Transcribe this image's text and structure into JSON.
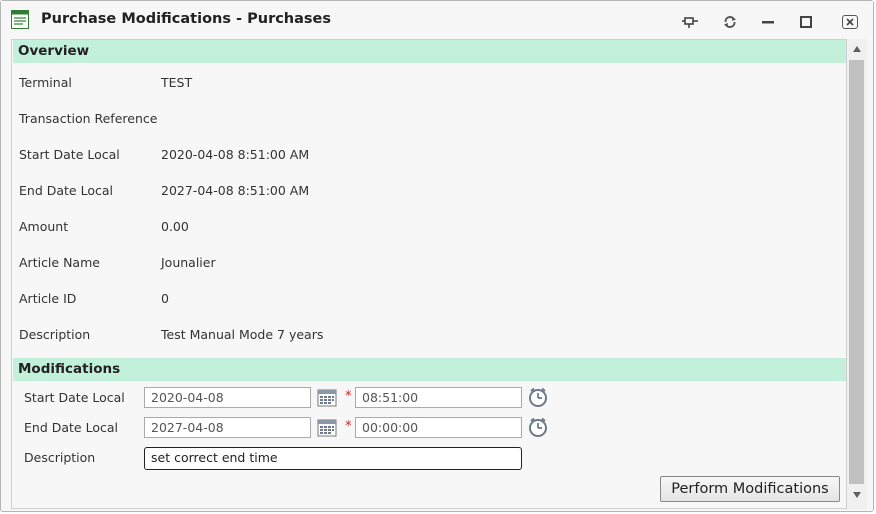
{
  "window": {
    "title": "Purchase Modifications - Purchases"
  },
  "overview": {
    "header": "Overview",
    "rows": [
      {
        "label": "Terminal",
        "value": "TEST"
      },
      {
        "label": "Transaction Reference",
        "value": ""
      },
      {
        "label": "Start Date Local",
        "value": "2020-04-08 8:51:00 AM"
      },
      {
        "label": "End Date Local",
        "value": "2027-04-08 8:51:00 AM"
      },
      {
        "label": "Amount",
        "value": "0.00"
      },
      {
        "label": "Article Name",
        "value": "Jounalier"
      },
      {
        "label": "Article ID",
        "value": "0"
      },
      {
        "label": "Description",
        "value": "Test Manual Mode 7 years"
      }
    ]
  },
  "modifications": {
    "header": "Modifications",
    "start_label": "Start Date Local",
    "start_date": "2020-04-08",
    "start_time": "08:51:00",
    "end_label": "End Date Local",
    "end_date": "2027-04-08",
    "end_time": "00:00:00",
    "description_label": "Description",
    "description_value": "set correct end time",
    "required_mark": "*",
    "perform_label": "Perform Modifications"
  },
  "icons": {
    "app": "document-list-icon",
    "pin": "pin-icon",
    "refresh": "refresh-icon",
    "minimize": "minimize-icon",
    "maximize": "maximize-icon",
    "close": "close-icon",
    "calendar": "calendar-icon",
    "clock": "clock-icon"
  },
  "colors": {
    "section_header_bg": "#c2f0da",
    "required": "#dd2222"
  }
}
